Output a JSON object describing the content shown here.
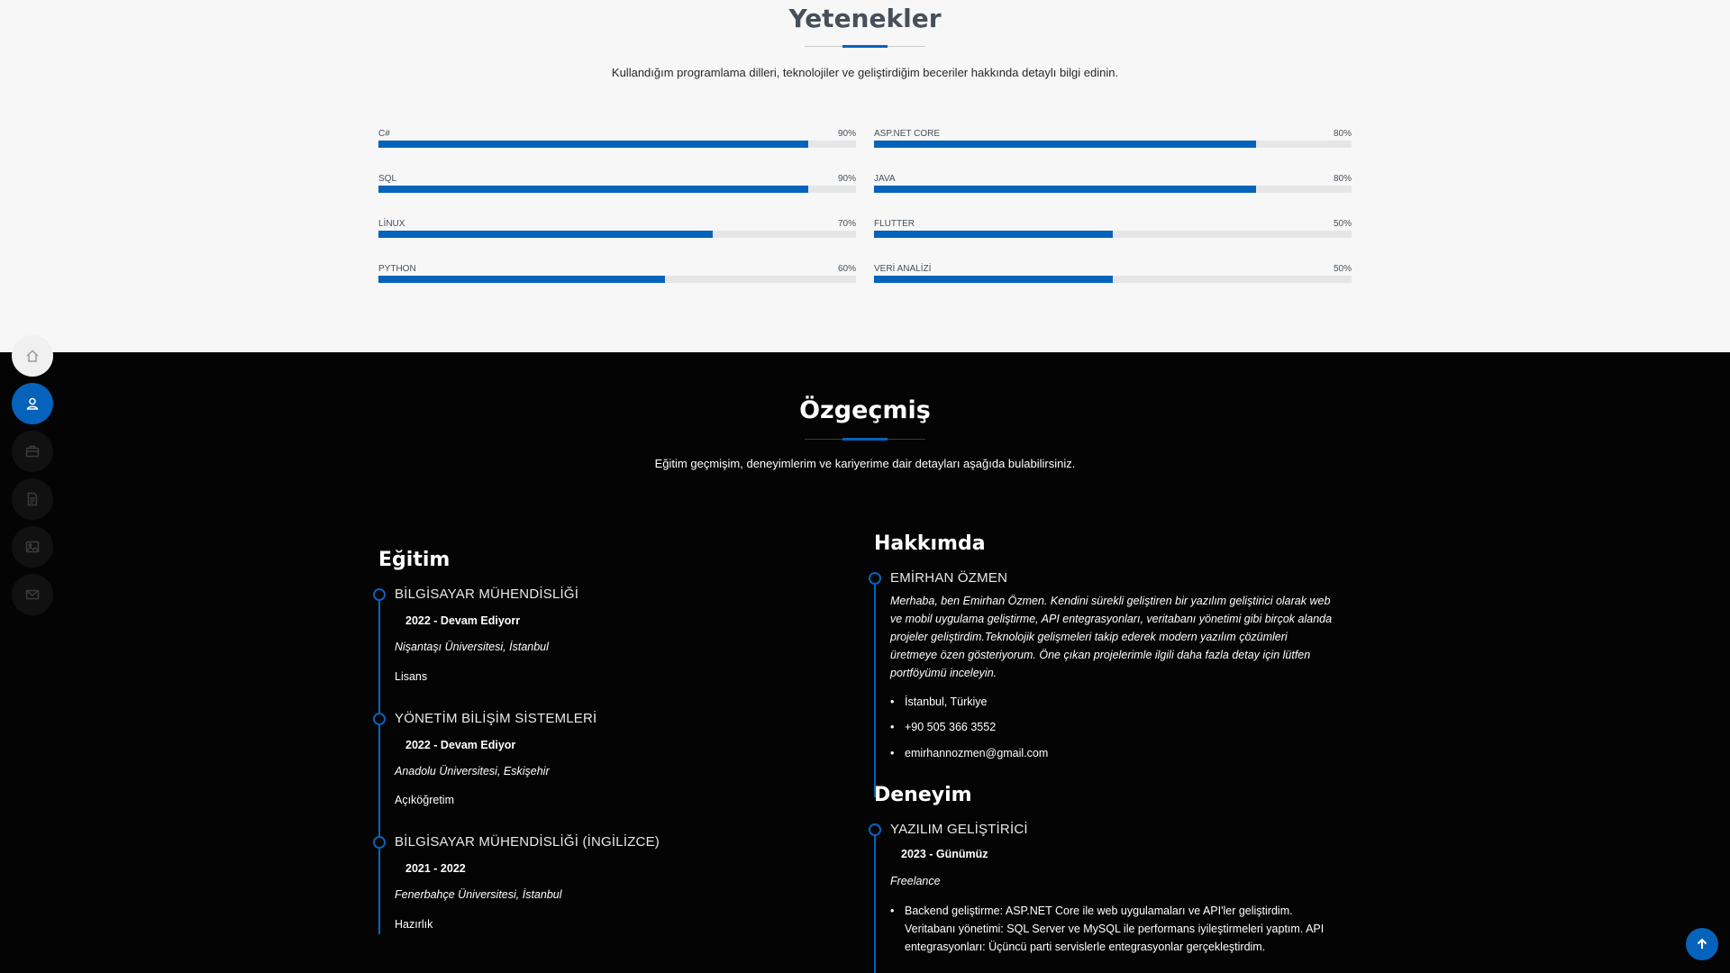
{
  "skills": {
    "title": "Yetenekler",
    "description": "Kullandığım programlama dilleri, teknolojiler ve geliştirdiğim beceriler hakkında detaylı bilgi edinin.",
    "left": [
      {
        "name": "C#",
        "value": "90%",
        "percent": 90
      },
      {
        "name": "SQL",
        "value": "90%",
        "percent": 90
      },
      {
        "name": "LİNUX",
        "value": "70%",
        "percent": 70
      },
      {
        "name": "PYTHON",
        "value": "60%",
        "percent": 60
      }
    ],
    "right": [
      {
        "name": "ASP.NET CORE",
        "value": "80%",
        "percent": 80
      },
      {
        "name": "JAVA",
        "value": "80%",
        "percent": 80
      },
      {
        "name": "FLUTTER",
        "value": "50%",
        "percent": 50
      },
      {
        "name": "VERİ ANALİZİ",
        "value": "50%",
        "percent": 50
      }
    ]
  },
  "resume": {
    "title": "Özgeçmiş",
    "description": "Eğitim geçmişim, deneyimlerim ve kariyerime dair detayları aşağıda bulabilirsiniz.",
    "education": {
      "title": "Eğitim",
      "items": [
        {
          "title": "BİLGİSAYAR MÜHENDİSLİĞİ",
          "date": "2022 - Devam Ediyorr",
          "school": "Nişantaşı Üniversitesi, İstanbul",
          "type": "Lisans"
        },
        {
          "title": "YÖNETİM BİLİŞİM SİSTEMLERİ",
          "date": "2022 - Devam Ediyor",
          "school": "Anadolu Üniversitesi, Eskişehir",
          "type": "Açıköğretim"
        },
        {
          "title": "BİLGİSAYAR MÜHENDİSLİĞİ (İNGİLİZCE)",
          "date": "2021 - 2022",
          "school": "Fenerbahçe Üniversitesi, İstanbul",
          "type": "Hazırlık"
        }
      ]
    },
    "about": {
      "title": "Hakkımda",
      "name": "EMİRHAN ÖZMEN",
      "text_lines": [
        "Merhaba, ben Emirhan Özmen. Kendini sürekli geliştiren bir yazılım geliştirici olarak web",
        "ve mobil uygulama geliştirme, API entegrasyonları, veritabanı yönetimi gibi birçok alanda",
        "projeler geliştirdim.Teknolojik gelişmeleri takip ederek modern yazılım çözümleri",
        "üretmeye özen gösteriyorum. Öne çıkan projelerimle ilgili daha fazla detay için lütfen",
        "portföyümü inceleyin."
      ],
      "location": "İstanbul, Türkiye",
      "phone": "+90 505 366 3552",
      "email": "emirhannozmen@gmail.com"
    },
    "experience": {
      "title": "Deneyim",
      "job_title": "YAZILIM GELİŞTİRİCİ",
      "date": "2023 - Günümüz",
      "company": "Freelance",
      "lines": [
        "Backend geliştirme: ASP.NET Core ile web uygulamaları ve API'ler geliştirdim.",
        "Veritabanı yönetimi: SQL Server ve MySQL ile performans iyileştirmeleri yaptım. API",
        "entegrasyonları: Üçüncü parti servislerle entegrasyonlar gerçekleştirdim."
      ]
    }
  },
  "nav": {
    "items": [
      "home-icon",
      "user-icon",
      "briefcase-icon",
      "file-icon",
      "image-icon",
      "mail-icon"
    ],
    "active": "user-icon"
  },
  "colors": {
    "accent": "#0563bb",
    "dark_bg": "#040404",
    "light_bg": "#f7f7f7"
  }
}
